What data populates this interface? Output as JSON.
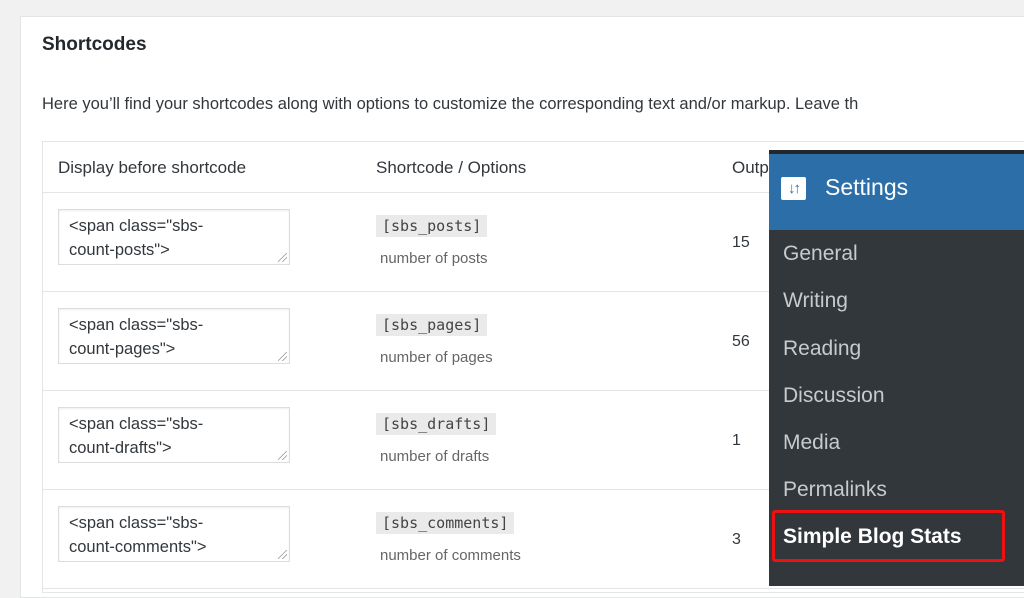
{
  "page": {
    "title": "Shortcodes",
    "description": "Here you’ll find your shortcodes along with options to customize the corresponding text and/or markup. Leave th"
  },
  "table": {
    "headers": [
      "Display before shortcode",
      "Shortcode / Options",
      "Outp"
    ],
    "rows": [
      {
        "before": "<span class=\"sbs-\ncount-posts\">",
        "shortcode": "[sbs_posts]",
        "desc": "number of posts",
        "output": "15"
      },
      {
        "before": "<span class=\"sbs-\ncount-pages\">",
        "shortcode": "[sbs_pages]",
        "desc": "number of pages",
        "output": "56"
      },
      {
        "before": "<span class=\"sbs-\ncount-drafts\">",
        "shortcode": "[sbs_drafts]",
        "desc": "number of drafts",
        "output": "1"
      },
      {
        "before": "<span class=\"sbs-\ncount-comments\">",
        "shortcode": "[sbs_comments]",
        "desc": "number of comments",
        "output": "3"
      }
    ]
  },
  "settings_menu": {
    "title": "Settings",
    "icon": "settings-sliders-icon",
    "icon_glyph": "↓↑",
    "items": [
      "General",
      "Writing",
      "Reading",
      "Discussion",
      "Media",
      "Permalinks",
      "Simple Blog Stats"
    ],
    "active_item": "Simple Blog Stats",
    "colors": {
      "header": "#2c6fa8",
      "background": "#32373c",
      "highlight": "#ee1111"
    }
  }
}
